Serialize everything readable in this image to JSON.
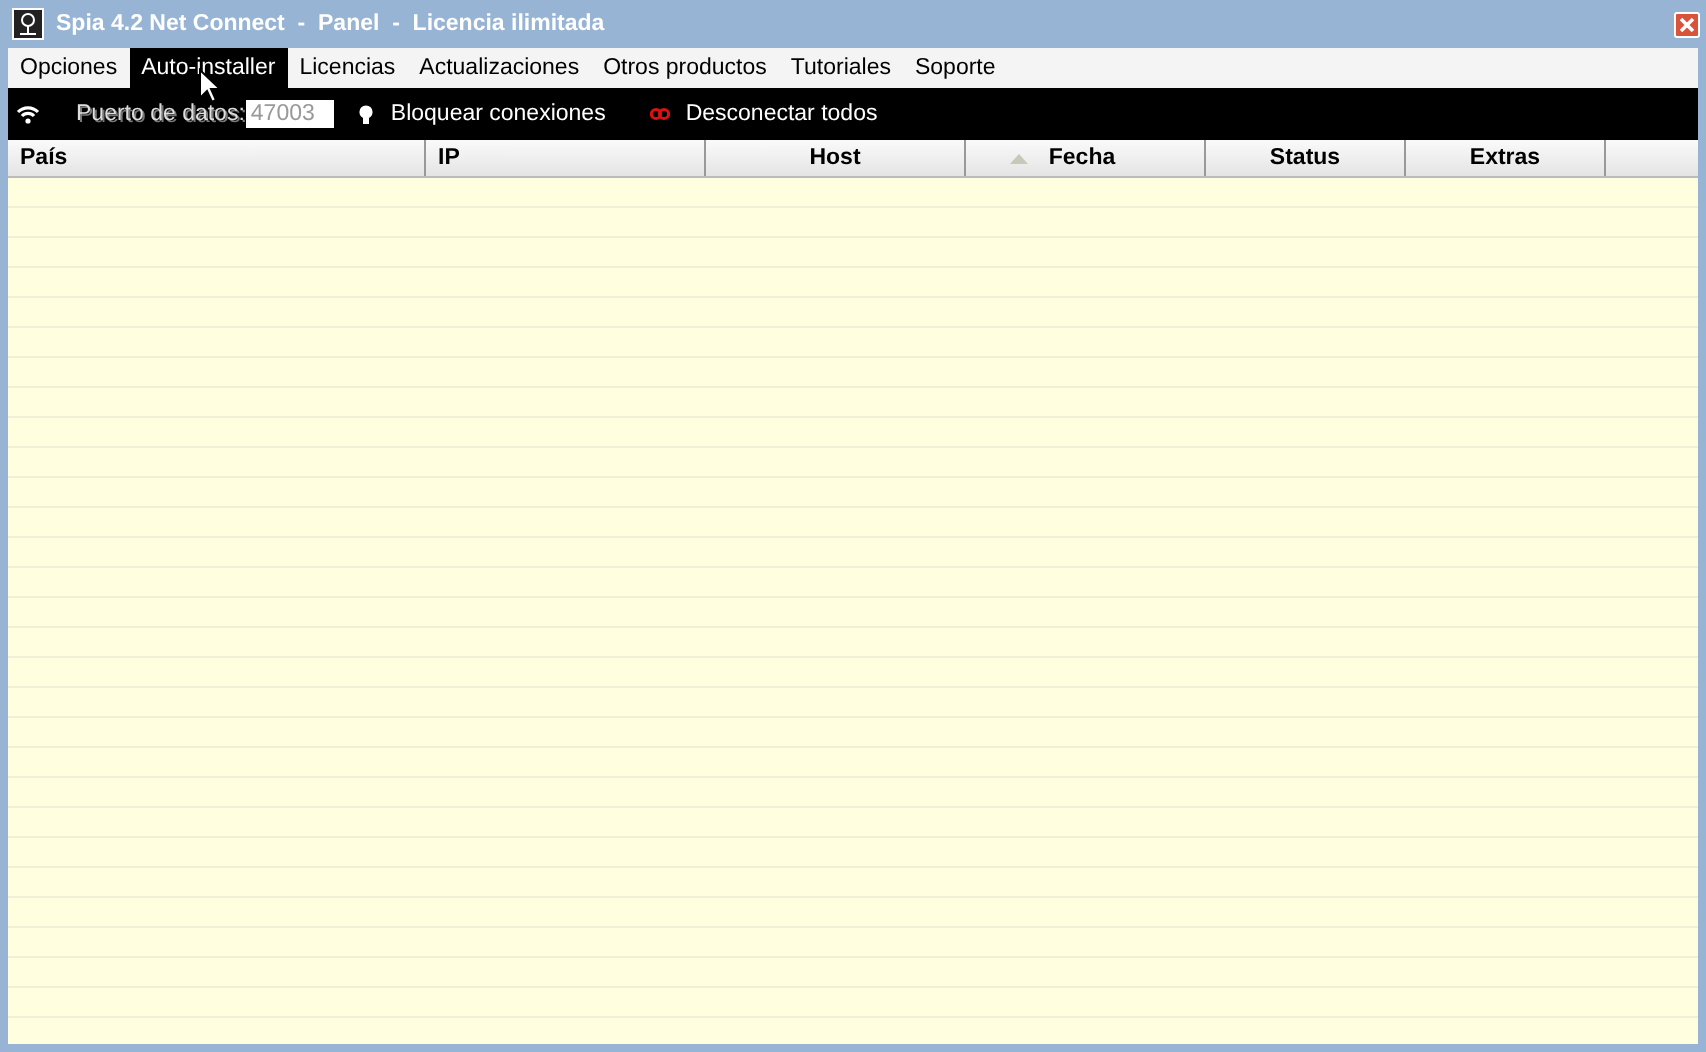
{
  "window": {
    "title": "Spia 4.2 Net Connect  -  Panel  -  Licencia ilimitada"
  },
  "menu": [
    {
      "label": "Opciones",
      "selected": false
    },
    {
      "label": "Auto-installer",
      "selected": true
    },
    {
      "label": "Licencias",
      "selected": false
    },
    {
      "label": "Actualizaciones",
      "selected": false
    },
    {
      "label": "Otros productos",
      "selected": false
    },
    {
      "label": "Tutoriales",
      "selected": false
    },
    {
      "label": "Soporte",
      "selected": false
    }
  ],
  "toolbar": {
    "port_label": "Puerto de datos:",
    "port_value": "47003",
    "block_button": "Bloquear conexiones",
    "disconnect_button": "Desconectar todos"
  },
  "table": {
    "columns": [
      {
        "label": "País",
        "sorted": false
      },
      {
        "label": "IP",
        "sorted": false
      },
      {
        "label": "Host",
        "sorted": false
      },
      {
        "label": "Fecha",
        "sorted": true
      },
      {
        "label": "Status",
        "sorted": false
      },
      {
        "label": "Extras",
        "sorted": false
      }
    ]
  }
}
